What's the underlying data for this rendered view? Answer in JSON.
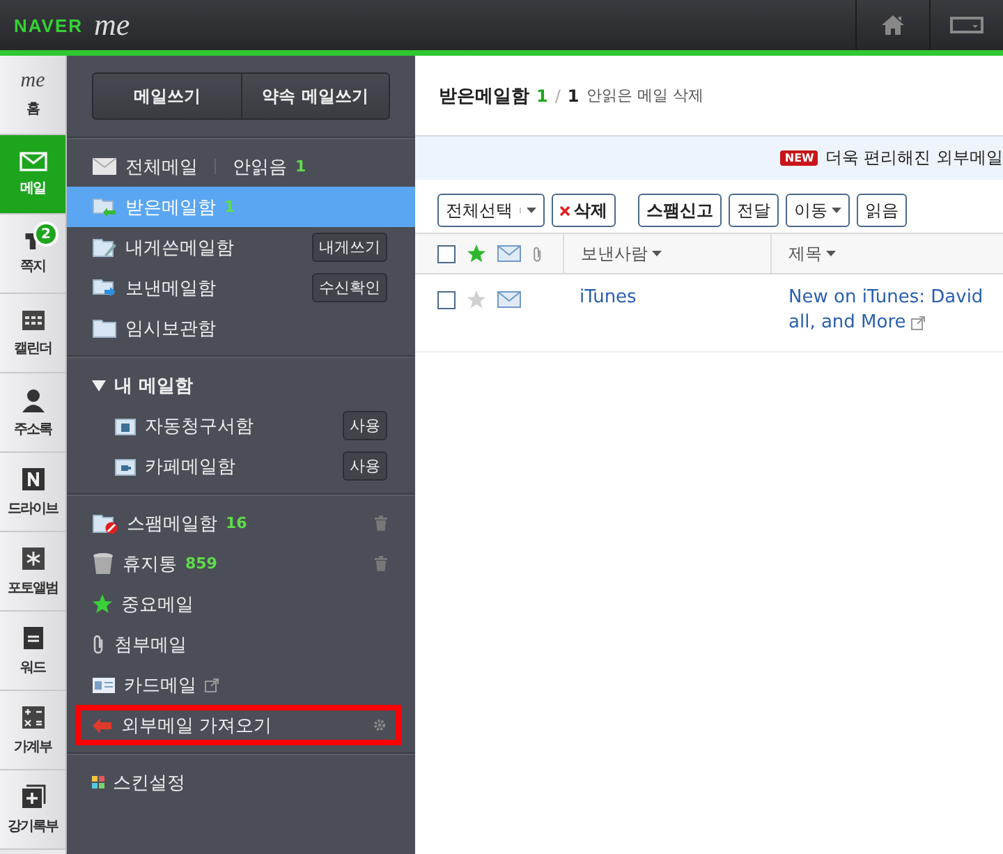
{
  "topbar": {
    "brand": "NAVER",
    "logo": "me"
  },
  "rail": [
    {
      "label": "홈",
      "logo": "me",
      "selected": false
    },
    {
      "label": "메일",
      "selected": true
    },
    {
      "label": "쪽지",
      "badge": "2",
      "selected": false
    },
    {
      "label": "캘린더",
      "selected": false
    },
    {
      "label": "주소록",
      "selected": false
    },
    {
      "label": "드라이브",
      "selected": false
    },
    {
      "label": "포토앨범",
      "selected": false
    },
    {
      "label": "워드",
      "selected": false
    },
    {
      "label": "가계부",
      "selected": false
    },
    {
      "label": "강기록부",
      "selected": false
    }
  ],
  "sidebar": {
    "buttons": [
      "메일쓰기",
      "약속 메일쓰기"
    ],
    "all_mail": {
      "label": "전체메일",
      "unread_label": "안읽음",
      "unread_count": "1"
    },
    "folders": [
      {
        "label": "받은메일함",
        "count": "1",
        "selected": true
      },
      {
        "label": "내게쓴메일함",
        "action": "내게쓰기",
        "selected": false
      },
      {
        "label": "보낸메일함",
        "action": "수신확인",
        "selected": false
      },
      {
        "label": "임시보관함",
        "selected": false
      }
    ],
    "my_mailbox": {
      "label": "내 메일함",
      "expanded": true,
      "children": [
        {
          "label": "자동청구서함",
          "action": "사용"
        },
        {
          "label": "카페메일함",
          "action": "사용"
        }
      ]
    },
    "special": [
      {
        "label": "스팸메일함",
        "count": "16",
        "highlighted": false
      },
      {
        "label": "휴지통",
        "count": "859",
        "highlighted": false
      },
      {
        "label": "중요메일",
        "highlighted": false
      },
      {
        "label": "첨부메일",
        "highlighted": false
      },
      {
        "label": "카드메일",
        "highlighted": false
      },
      {
        "label": "외부메일 가져오기",
        "highlighted": true
      }
    ],
    "skin": "스킨설정"
  },
  "main": {
    "header": {
      "title": "받은메일함",
      "unread": "1",
      "separator": "/",
      "total": "1",
      "action": "안읽은 메일 삭제"
    },
    "banner": {
      "badge": "NEW",
      "text": "더욱 편리해진 외부메일"
    },
    "toolbar": [
      {
        "label": "전체선택",
        "kind": "split"
      },
      {
        "label": "삭제",
        "kind": "delete"
      },
      {
        "label": "스팸신고",
        "kind": "plain"
      },
      {
        "label": "전달",
        "kind": "plain"
      },
      {
        "label": "이동",
        "kind": "dropdown"
      },
      {
        "label": "읽음",
        "kind": "plain"
      }
    ],
    "table": {
      "header": {
        "checked": false
      },
      "columns": [
        "보낸사람",
        "제목"
      ],
      "rows": [
        {
          "checked": false,
          "starred": false,
          "sender": "iTunes",
          "subject": "New on iTunes: David",
          "subject_more": "all, and More"
        }
      ]
    }
  }
}
